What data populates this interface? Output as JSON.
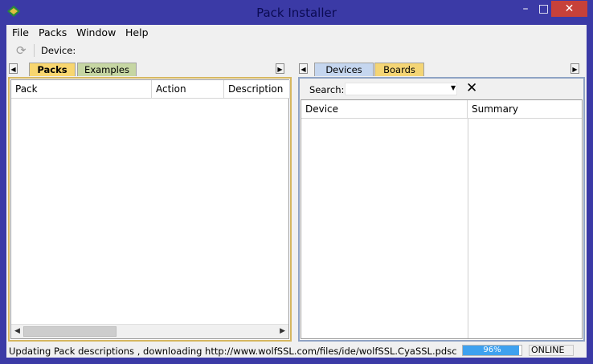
{
  "window": {
    "title": "Pack Installer",
    "min": "–",
    "max": "□",
    "close": "✕"
  },
  "menu": [
    "File",
    "Packs",
    "Window",
    "Help"
  ],
  "toolbar": {
    "device_label": "Device:"
  },
  "left_pane": {
    "tabs": [
      "Packs",
      "Examples"
    ],
    "columns": [
      "Pack",
      "Action",
      "Description"
    ]
  },
  "right_pane": {
    "tabs": [
      "Devices",
      "Boards"
    ],
    "search_label": "Search:",
    "search_value": "",
    "columns": [
      "Device",
      "Summary"
    ]
  },
  "status": {
    "message": "Updating Pack descriptions , downloading http://www.wolfSSL.com/files/ide/wolfSSL.CyaSSL.pdsc",
    "progress_text": "96%",
    "progress_value": 0.96,
    "online": "ONLINE"
  },
  "colors": {
    "title_bar": "#3b3aa6",
    "close_button": "#c7413a",
    "packs_tab": "#f8d66f",
    "examples_tab": "#c6d6a3",
    "devices_tab": "#c5d6ef",
    "boards_tab": "#f4d575",
    "progress": "#3ea1ef"
  },
  "icons": [
    "app-icon",
    "refresh-icon",
    "scroll-left-icon",
    "scroll-right-icon",
    "dropdown-arrow-icon",
    "clear-search-icon"
  ]
}
